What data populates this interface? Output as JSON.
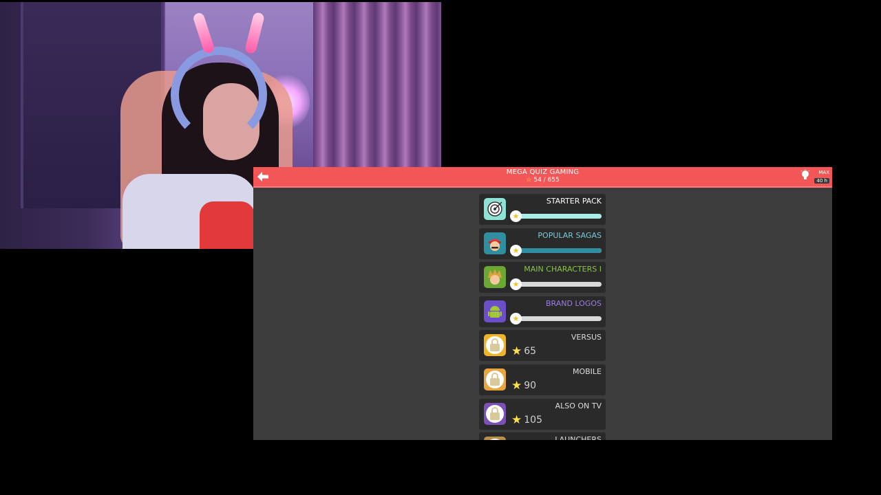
{
  "game": {
    "title": "MEGA QUIZ GAMING",
    "score": "54 / 655",
    "hints": {
      "max_label": "MAX",
      "count": "40 h"
    }
  },
  "packs": [
    {
      "label": "STARTER PACK",
      "label_color": "#ffffff",
      "icon": "target-icon",
      "icon_bg": "#8fe3d6",
      "progress": 1.0,
      "bar_color": "#a8f0e6"
    },
    {
      "label": "POPULAR SAGAS",
      "label_color": "#7fc9d6",
      "icon": "mario-icon",
      "icon_bg": "#2f8fa0",
      "progress": 1.0,
      "bar_color": "#2f8fa0"
    },
    {
      "label": "MAIN CHARACTERS I",
      "label_color": "#8bc34a",
      "icon": "spiky-hair-icon",
      "icon_bg": "#6aa833",
      "progress": 0.0,
      "bar_color": "#8bc34a"
    },
    {
      "label": "BRAND LOGOS",
      "label_color": "#9b7fe0",
      "icon": "android-icon",
      "icon_bg": "#6c4fc8",
      "progress": 0.0,
      "bar_color": "#9b7fe0"
    },
    {
      "label": "VERSUS",
      "label_color": "#dcdcdc",
      "icon": "lock-icon",
      "icon_bg": "#f0b429",
      "locked": true,
      "required": "65"
    },
    {
      "label": "MOBILE",
      "label_color": "#dcdcdc",
      "icon": "lock-icon",
      "icon_bg": "#e8a640",
      "locked": true,
      "required": "90"
    },
    {
      "label": "ALSO ON TV",
      "label_color": "#dcdcdc",
      "icon": "lock-icon",
      "icon_bg": "#7d4fb8",
      "locked": true,
      "required": "105"
    },
    {
      "label": "LAUNCHERS",
      "label_color": "#dcdcdc",
      "icon": "lock-icon",
      "icon_bg": "#b8904a",
      "locked": true,
      "required": ""
    }
  ],
  "colors": {
    "topbar": "#f25656",
    "background": "#3c3c3c",
    "card": "#2a2a2a"
  }
}
